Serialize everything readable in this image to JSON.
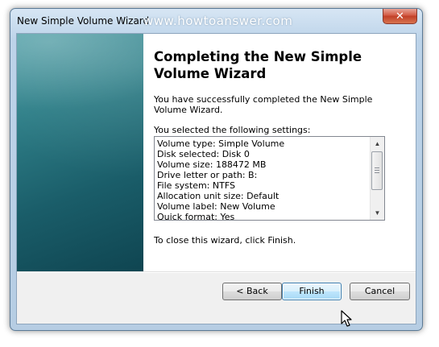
{
  "window": {
    "title": "New Simple Volume Wizard",
    "watermark": "www.howtoanswer.com",
    "close_glyph": "✕"
  },
  "page": {
    "heading": "Completing the New Simple Volume Wizard",
    "success_text": "You have successfully completed the New Simple Volume Wizard.",
    "selected_label": "You selected the following settings:",
    "settings": [
      "Volume type: Simple Volume",
      "Disk selected: Disk 0",
      "Volume size: 188472 MB",
      "Drive letter or path: B:",
      "File system: NTFS",
      "Allocation unit size: Default",
      "Volume label: New Volume",
      "Quick format: Yes"
    ],
    "close_instruction": "To close this wizard, click Finish."
  },
  "buttons": {
    "back": "< Back",
    "finish": "Finish",
    "cancel": "Cancel"
  },
  "icons": {
    "scroll_up": "up-arrow-icon",
    "scroll_down": "down-arrow-icon",
    "cursor": "mouse-pointer-icon"
  },
  "colors": {
    "sidebar_teal": "#1a5d69",
    "finish_highlight": "#bee6fd",
    "close_button": "#c13f28"
  }
}
